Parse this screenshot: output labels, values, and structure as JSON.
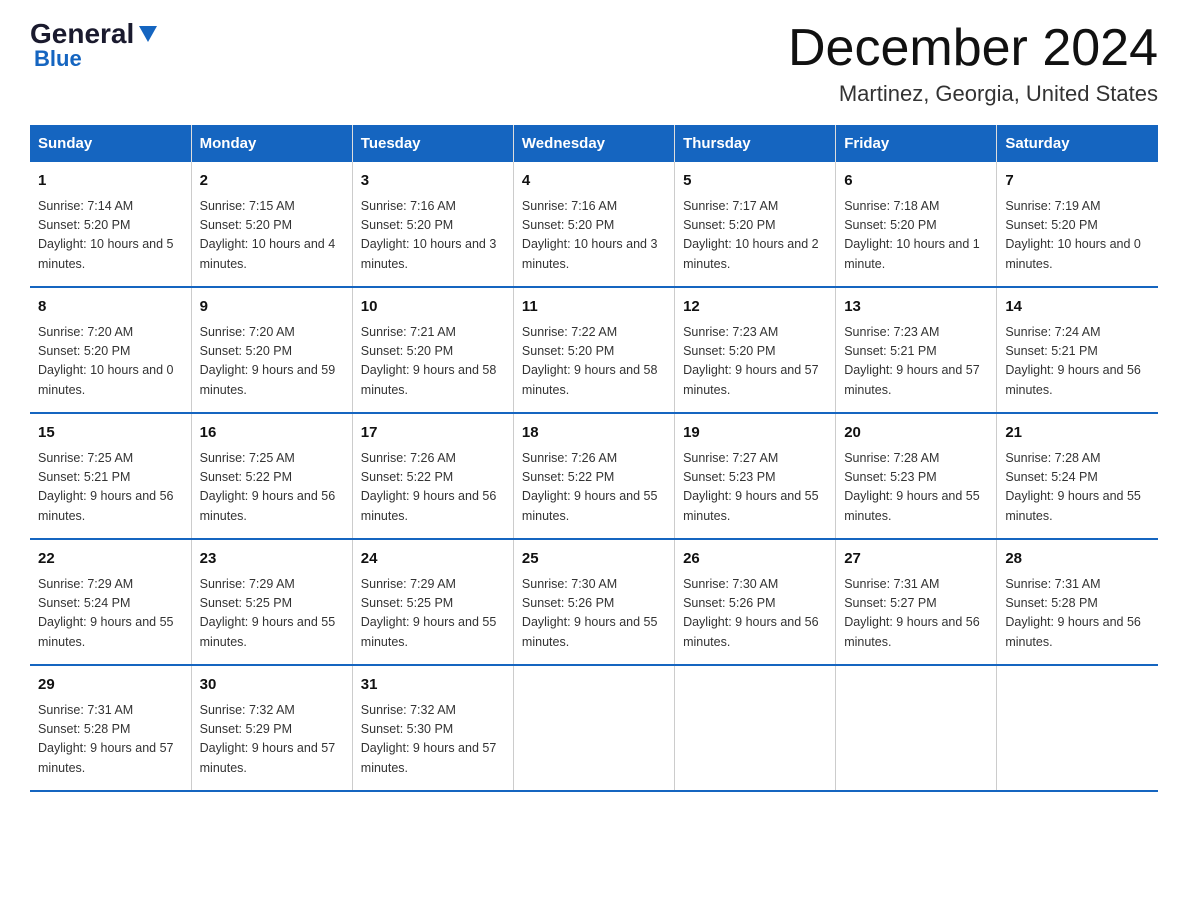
{
  "logo": {
    "text_general": "General",
    "text_blue": "Blue"
  },
  "header": {
    "title": "December 2024",
    "subtitle": "Martinez, Georgia, United States"
  },
  "columns": [
    "Sunday",
    "Monday",
    "Tuesday",
    "Wednesday",
    "Thursday",
    "Friday",
    "Saturday"
  ],
  "weeks": [
    [
      {
        "day": "1",
        "sunrise": "7:14 AM",
        "sunset": "5:20 PM",
        "daylight": "10 hours and 5 minutes."
      },
      {
        "day": "2",
        "sunrise": "7:15 AM",
        "sunset": "5:20 PM",
        "daylight": "10 hours and 4 minutes."
      },
      {
        "day": "3",
        "sunrise": "7:16 AM",
        "sunset": "5:20 PM",
        "daylight": "10 hours and 3 minutes."
      },
      {
        "day": "4",
        "sunrise": "7:16 AM",
        "sunset": "5:20 PM",
        "daylight": "10 hours and 3 minutes."
      },
      {
        "day": "5",
        "sunrise": "7:17 AM",
        "sunset": "5:20 PM",
        "daylight": "10 hours and 2 minutes."
      },
      {
        "day": "6",
        "sunrise": "7:18 AM",
        "sunset": "5:20 PM",
        "daylight": "10 hours and 1 minute."
      },
      {
        "day": "7",
        "sunrise": "7:19 AM",
        "sunset": "5:20 PM",
        "daylight": "10 hours and 0 minutes."
      }
    ],
    [
      {
        "day": "8",
        "sunrise": "7:20 AM",
        "sunset": "5:20 PM",
        "daylight": "10 hours and 0 minutes."
      },
      {
        "day": "9",
        "sunrise": "7:20 AM",
        "sunset": "5:20 PM",
        "daylight": "9 hours and 59 minutes."
      },
      {
        "day": "10",
        "sunrise": "7:21 AM",
        "sunset": "5:20 PM",
        "daylight": "9 hours and 58 minutes."
      },
      {
        "day": "11",
        "sunrise": "7:22 AM",
        "sunset": "5:20 PM",
        "daylight": "9 hours and 58 minutes."
      },
      {
        "day": "12",
        "sunrise": "7:23 AM",
        "sunset": "5:20 PM",
        "daylight": "9 hours and 57 minutes."
      },
      {
        "day": "13",
        "sunrise": "7:23 AM",
        "sunset": "5:21 PM",
        "daylight": "9 hours and 57 minutes."
      },
      {
        "day": "14",
        "sunrise": "7:24 AM",
        "sunset": "5:21 PM",
        "daylight": "9 hours and 56 minutes."
      }
    ],
    [
      {
        "day": "15",
        "sunrise": "7:25 AM",
        "sunset": "5:21 PM",
        "daylight": "9 hours and 56 minutes."
      },
      {
        "day": "16",
        "sunrise": "7:25 AM",
        "sunset": "5:22 PM",
        "daylight": "9 hours and 56 minutes."
      },
      {
        "day": "17",
        "sunrise": "7:26 AM",
        "sunset": "5:22 PM",
        "daylight": "9 hours and 56 minutes."
      },
      {
        "day": "18",
        "sunrise": "7:26 AM",
        "sunset": "5:22 PM",
        "daylight": "9 hours and 55 minutes."
      },
      {
        "day": "19",
        "sunrise": "7:27 AM",
        "sunset": "5:23 PM",
        "daylight": "9 hours and 55 minutes."
      },
      {
        "day": "20",
        "sunrise": "7:28 AM",
        "sunset": "5:23 PM",
        "daylight": "9 hours and 55 minutes."
      },
      {
        "day": "21",
        "sunrise": "7:28 AM",
        "sunset": "5:24 PM",
        "daylight": "9 hours and 55 minutes."
      }
    ],
    [
      {
        "day": "22",
        "sunrise": "7:29 AM",
        "sunset": "5:24 PM",
        "daylight": "9 hours and 55 minutes."
      },
      {
        "day": "23",
        "sunrise": "7:29 AM",
        "sunset": "5:25 PM",
        "daylight": "9 hours and 55 minutes."
      },
      {
        "day": "24",
        "sunrise": "7:29 AM",
        "sunset": "5:25 PM",
        "daylight": "9 hours and 55 minutes."
      },
      {
        "day": "25",
        "sunrise": "7:30 AM",
        "sunset": "5:26 PM",
        "daylight": "9 hours and 55 minutes."
      },
      {
        "day": "26",
        "sunrise": "7:30 AM",
        "sunset": "5:26 PM",
        "daylight": "9 hours and 56 minutes."
      },
      {
        "day": "27",
        "sunrise": "7:31 AM",
        "sunset": "5:27 PM",
        "daylight": "9 hours and 56 minutes."
      },
      {
        "day": "28",
        "sunrise": "7:31 AM",
        "sunset": "5:28 PM",
        "daylight": "9 hours and 56 minutes."
      }
    ],
    [
      {
        "day": "29",
        "sunrise": "7:31 AM",
        "sunset": "5:28 PM",
        "daylight": "9 hours and 57 minutes."
      },
      {
        "day": "30",
        "sunrise": "7:32 AM",
        "sunset": "5:29 PM",
        "daylight": "9 hours and 57 minutes."
      },
      {
        "day": "31",
        "sunrise": "7:32 AM",
        "sunset": "5:30 PM",
        "daylight": "9 hours and 57 minutes."
      },
      null,
      null,
      null,
      null
    ]
  ],
  "labels": {
    "sunrise": "Sunrise:",
    "sunset": "Sunset:",
    "daylight": "Daylight:"
  }
}
